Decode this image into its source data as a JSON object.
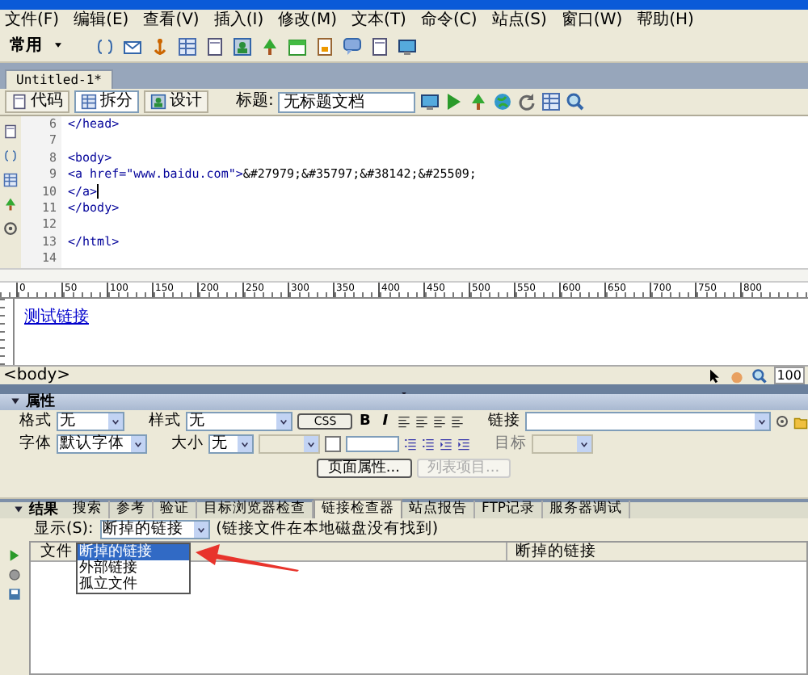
{
  "menu": [
    "文件(F)",
    "编辑(E)",
    "查看(V)",
    "插入(I)",
    "修改(M)",
    "文本(T)",
    "命令(C)",
    "站点(S)",
    "窗口(W)",
    "帮助(H)"
  ],
  "insert_bar": {
    "category": "常用"
  },
  "document_tab": {
    "title": "Untitled-1*"
  },
  "doc_toolbar": {
    "views": [
      {
        "label": "代码",
        "selected": false
      },
      {
        "label": "拆分",
        "selected": true
      },
      {
        "label": "设计",
        "selected": false
      }
    ],
    "title_label": "标题:",
    "title_value": "无标题文档"
  },
  "code": {
    "lines": [
      {
        "number": "6",
        "segments": [
          {
            "kind": "tag",
            "text": "</head>"
          }
        ]
      },
      {
        "number": "7"
      },
      {
        "number": "8",
        "segments": [
          {
            "kind": "tag",
            "text": "<body>"
          }
        ]
      },
      {
        "number": "9",
        "segments": [
          {
            "kind": "tag",
            "text": "<a href=\"www.baidu.com\">"
          },
          {
            "kind": "text",
            "text": "&#27979;&#35797;&#38142;&#25509;"
          }
        ]
      },
      {
        "number": "10",
        "segments": [
          {
            "kind": "tag",
            "text": "</a>"
          }
        ],
        "cursor": true
      },
      {
        "number": "11",
        "segments": [
          {
            "kind": "tag",
            "text": "</body>"
          }
        ]
      },
      {
        "number": "12"
      },
      {
        "number": "13",
        "segments": [
          {
            "kind": "tag",
            "text": "</html>"
          }
        ]
      },
      {
        "number": "14"
      }
    ]
  },
  "design": {
    "ruler_labels": [
      "0",
      "50",
      "100",
      "150",
      "200",
      "250",
      "300",
      "350",
      "400",
      "450",
      "500",
      "550",
      "600",
      "650",
      "700",
      "750",
      "800"
    ],
    "link": "测试链接"
  },
  "status_bar": {
    "tag": "<body>",
    "zoom": "100"
  },
  "properties": {
    "title": "属性",
    "format": {
      "label": "格式",
      "value": "无"
    },
    "style": {
      "label": "样式",
      "value": "无"
    },
    "css_button": "CSS",
    "bold_button": "B",
    "italic_button": "I",
    "link": {
      "label": "链接"
    },
    "font": {
      "label": "字体",
      "value": "默认字体"
    },
    "size": {
      "label": "大小",
      "value": "无"
    },
    "target": {
      "label": "目标",
      "disabled": true
    },
    "buttons": [
      {
        "label": "页面属性...",
        "disabled": false
      },
      {
        "label": "列表项目...",
        "disabled": true
      }
    ]
  },
  "results": {
    "title": "结果",
    "tabs": [
      {
        "label": "搜索",
        "selected": false
      },
      {
        "label": "参考",
        "selected": false
      },
      {
        "label": "验证",
        "selected": false
      },
      {
        "label": "目标浏览器检查",
        "selected": false
      },
      {
        "label": "链接检查器",
        "selected": true
      },
      {
        "label": "站点报告",
        "selected": false
      },
      {
        "label": "FTP记录",
        "selected": false
      },
      {
        "label": "服务器调试",
        "selected": false
      }
    ],
    "show_label": "显示(S):",
    "show_value": "断掉的链接",
    "note": "(链接文件在本地磁盘没有找到)",
    "dropdown": [
      {
        "label": "断掉的链接",
        "selected": true
      },
      {
        "label": "外部链接",
        "selected": false
      },
      {
        "label": "孤立文件",
        "selected": false
      }
    ],
    "columns": [
      "文件",
      "断掉的链接"
    ]
  }
}
